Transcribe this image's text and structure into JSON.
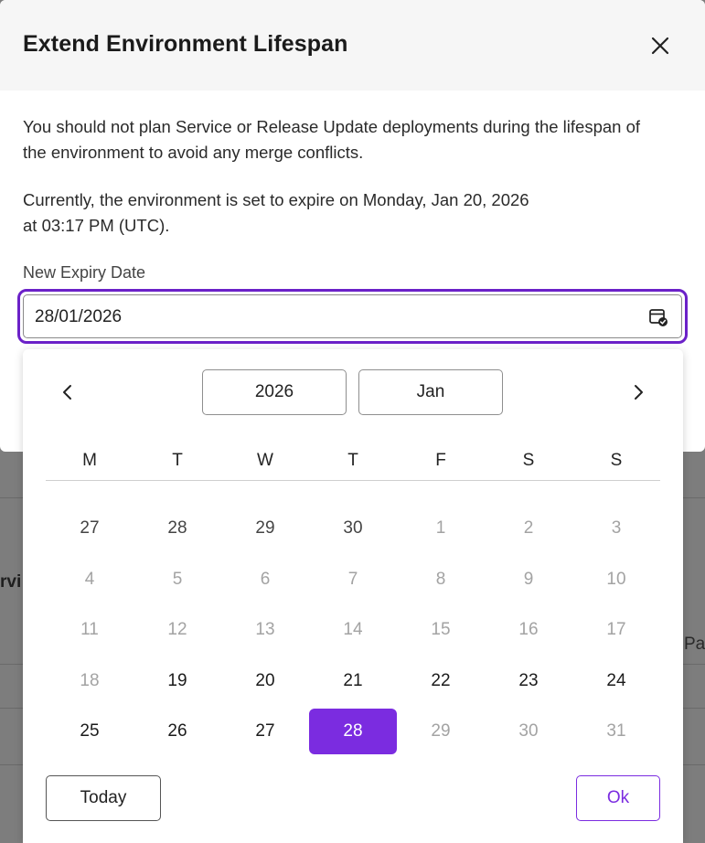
{
  "background": {
    "fragment_left": "rvi",
    "fragment_right": "Pas"
  },
  "modal": {
    "title": "Extend Environment Lifespan",
    "close_icon": "close-icon",
    "paragraph1": "You should not plan Service or Release Update deployments during the lifespan of the environment to avoid any merge conflicts.",
    "paragraph2_line1": "Currently, the environment is set to expire on Monday, Jan 20, 2026",
    "paragraph2_line2": "at 03:17 PM (UTC).",
    "field_label": "New Expiry Date",
    "date_value": "28/01/2026",
    "calendar_icon": "calendar-check-icon"
  },
  "calendar": {
    "year": "2026",
    "month": "Jan",
    "prev_icon": "chevron-left-icon",
    "next_icon": "chevron-right-icon",
    "weekdays": [
      "M",
      "T",
      "W",
      "T",
      "F",
      "S",
      "S"
    ],
    "weeks": [
      [
        {
          "d": "27",
          "s": "outside"
        },
        {
          "d": "28",
          "s": "outside"
        },
        {
          "d": "29",
          "s": "outside"
        },
        {
          "d": "30",
          "s": "outside"
        },
        {
          "d": "1",
          "s": "disabled"
        },
        {
          "d": "2",
          "s": "disabled"
        },
        {
          "d": "3",
          "s": "disabled"
        }
      ],
      [
        {
          "d": "4",
          "s": "disabled"
        },
        {
          "d": "5",
          "s": "disabled"
        },
        {
          "d": "6",
          "s": "disabled"
        },
        {
          "d": "7",
          "s": "disabled"
        },
        {
          "d": "8",
          "s": "disabled"
        },
        {
          "d": "9",
          "s": "disabled"
        },
        {
          "d": "10",
          "s": "disabled"
        }
      ],
      [
        {
          "d": "11",
          "s": "disabled"
        },
        {
          "d": "12",
          "s": "disabled"
        },
        {
          "d": "13",
          "s": "disabled"
        },
        {
          "d": "14",
          "s": "disabled"
        },
        {
          "d": "15",
          "s": "disabled"
        },
        {
          "d": "16",
          "s": "disabled"
        },
        {
          "d": "17",
          "s": "disabled"
        }
      ],
      [
        {
          "d": "18",
          "s": "disabled"
        },
        {
          "d": "19",
          "s": "enabled"
        },
        {
          "d": "20",
          "s": "enabled"
        },
        {
          "d": "21",
          "s": "enabled"
        },
        {
          "d": "22",
          "s": "enabled"
        },
        {
          "d": "23",
          "s": "enabled"
        },
        {
          "d": "24",
          "s": "enabled"
        }
      ],
      [
        {
          "d": "25",
          "s": "enabled"
        },
        {
          "d": "26",
          "s": "enabled"
        },
        {
          "d": "27",
          "s": "enabled"
        },
        {
          "d": "28",
          "s": "selected"
        },
        {
          "d": "29",
          "s": "disabled"
        },
        {
          "d": "30",
          "s": "disabled"
        },
        {
          "d": "31",
          "s": "disabled"
        }
      ]
    ],
    "today_label": "Today",
    "ok_label": "Ok"
  },
  "colors": {
    "accent": "#7b2ce0",
    "focus_border": "#6b21c8",
    "overlay": "#7d7d7d"
  }
}
